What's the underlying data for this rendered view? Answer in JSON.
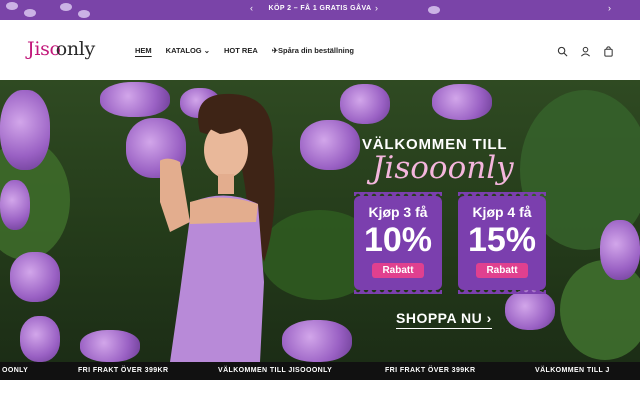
{
  "announcement": {
    "text": "KÖP 2 – FÅ 1 GRATIS GÅVA",
    "prev_icon": "chevron-left-icon",
    "next_icon": "chevron-right-icon",
    "bg_color": "#7a44a8"
  },
  "header": {
    "logo": {
      "part1": "Jiso",
      "part2": "only"
    },
    "nav": [
      {
        "label": "HEM",
        "active": true
      },
      {
        "label": "KATALOG ⌄",
        "active": false
      },
      {
        "label": "HOT REA",
        "active": false
      },
      {
        "label": "✈Spåra din beställning",
        "active": false
      }
    ],
    "icons": [
      "search-icon",
      "account-icon",
      "cart-icon"
    ]
  },
  "hero": {
    "welcome_line1": "VÄLKOMMEN TILL",
    "welcome_line2": "Jisooonly",
    "coupons": [
      {
        "label": "Kjøp 3 få",
        "percent": "10%",
        "badge": "Rabatt"
      },
      {
        "label": "Kjøp 4 få",
        "percent": "15%",
        "badge": "Rabatt"
      }
    ],
    "cta": "SHOPPA NU ›",
    "accent_color": "#7b3fae",
    "badge_color": "#e0408f"
  },
  "marquee": {
    "items": [
      "OONLY",
      "FRI FRAKT ÖVER 399KR",
      "VÄLKOMMEN TILL JISOOONLY",
      "FRI FRAKT ÖVER 399KR",
      "VÄLKOMMEN TILL J"
    ]
  }
}
